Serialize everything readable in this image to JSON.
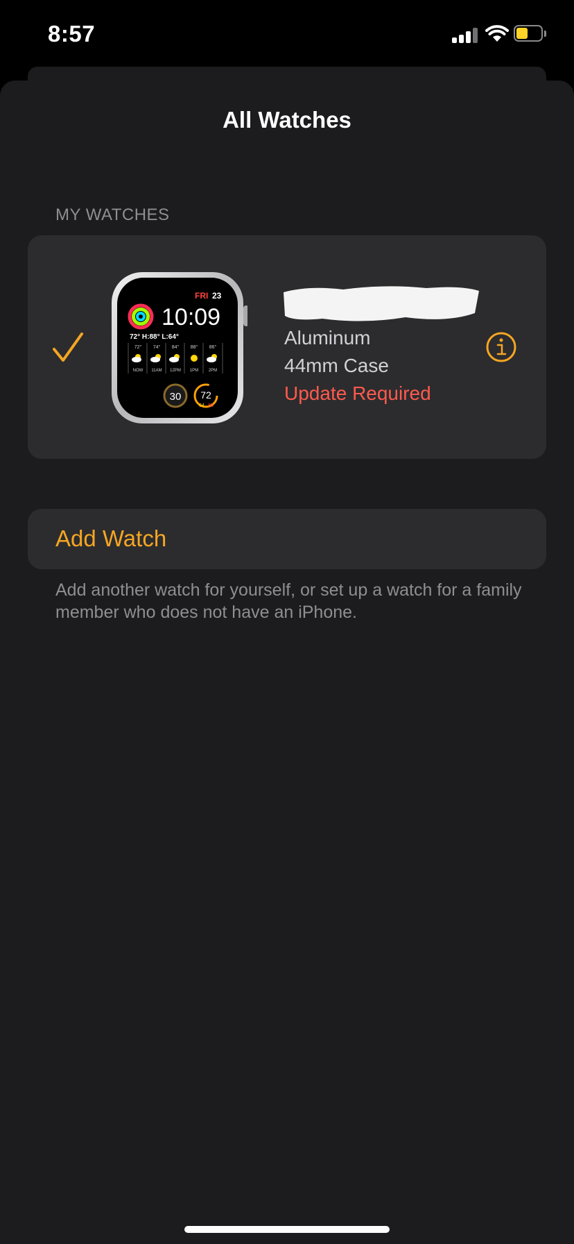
{
  "status_bar": {
    "time": "8:57",
    "battery_color": "#ffd426"
  },
  "sheet": {
    "title": "All Watches"
  },
  "my_watches": {
    "header": "MY WATCHES",
    "watch": {
      "selected": true,
      "material": "Aluminum",
      "case_size": "44mm Case",
      "status": "Update Required",
      "status_color": "#ff5a4e",
      "face": {
        "day": "FRI",
        "date": "23",
        "time": "10:09",
        "weather_summary": "72° H:88° L:64°",
        "forecast": [
          {
            "temp": "72°",
            "label": "NOW"
          },
          {
            "temp": "74°",
            "label": "11AM"
          },
          {
            "temp": "84°",
            "label": "12PM"
          },
          {
            "temp": "88°",
            "label": "1PM"
          },
          {
            "temp": "86°",
            "label": "2PM"
          }
        ],
        "timer": "30",
        "temp_gauge": "72",
        "temp_low": "64",
        "temp_high": "88"
      }
    }
  },
  "add_watch": {
    "label": "Add Watch",
    "description": "Add another watch for yourself, or set up a watch for a family member who does not have an iPhone."
  },
  "colors": {
    "accent": "#f5a623",
    "background": "#1c1c1e",
    "card": "#2c2c2e"
  }
}
